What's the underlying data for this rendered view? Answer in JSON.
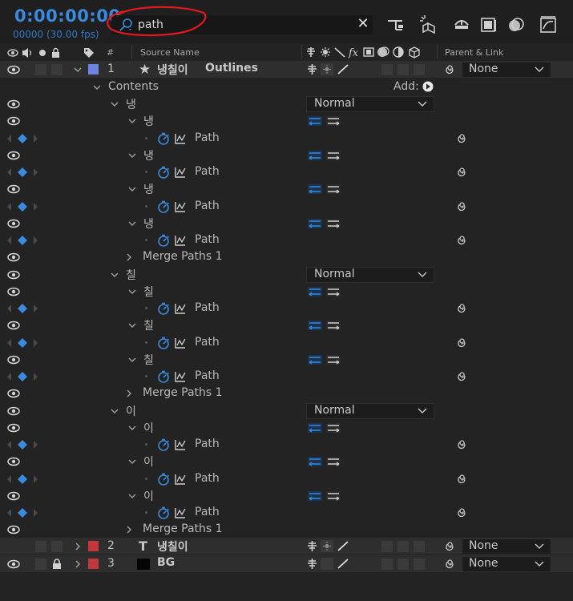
{
  "header": {
    "timecode": "0:00:00:00",
    "frames_fps": "00000 (30.00 fps)",
    "search_value": "path"
  },
  "columns": {
    "number": "#",
    "source_name": "Source Name",
    "parent_link": "Parent & Link"
  },
  "layers": [
    {
      "number": "1",
      "type_glyph": "★",
      "name": "냉칠이",
      "name_suffix": "Outlines",
      "color": "#6d83e0",
      "parent": "None"
    },
    {
      "number": "2",
      "type_glyph": "T",
      "name": "냉칠이",
      "color": "#c0383c",
      "parent": "None"
    },
    {
      "number": "3",
      "name": "BG",
      "color": "#c0383c",
      "parent": "None"
    }
  ],
  "contents": {
    "label": "Contents",
    "add_label": "Add:"
  },
  "groups": [
    {
      "name": "냉",
      "blend": "Normal",
      "sub": [
        "냉",
        "냉",
        "냉",
        "냉"
      ]
    },
    {
      "name": "칠",
      "blend": "Normal",
      "sub": [
        "칠",
        "칠",
        "칠"
      ]
    },
    {
      "name": "이",
      "blend": "Normal",
      "sub": [
        "이",
        "이",
        "이"
      ]
    }
  ],
  "path_label": "Path",
  "merge_label": "Merge Paths 1",
  "colors": {
    "accent": "#3a8bde",
    "annotation": "#e0191e",
    "background": "#232323"
  }
}
